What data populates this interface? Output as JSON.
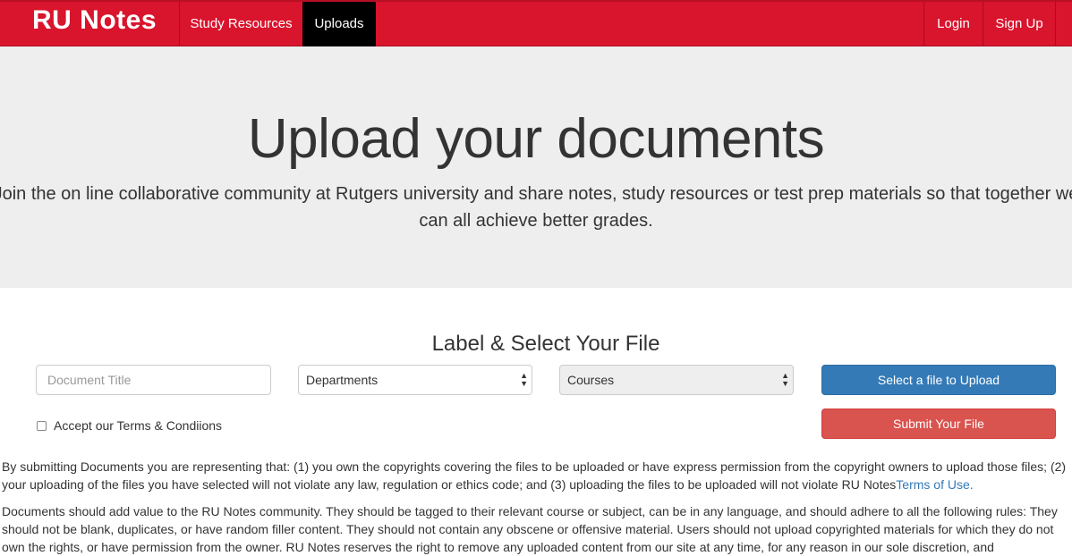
{
  "nav": {
    "brand": "RU Notes",
    "links": [
      "Study Resources",
      "Uploads"
    ],
    "login": "Login",
    "signup": "Sign Up"
  },
  "hero": {
    "title": "Upload your documents",
    "subtitle": "Join the on line collaborative community at Rutgers university and share notes, study resources or test prep materials so that together we can all achieve better grades."
  },
  "form": {
    "title": "Label & Select Your File",
    "doc_title_placeholder": "Document Title",
    "departments": "Departments",
    "courses": "Courses",
    "select_file": "Select a file to Upload",
    "submit": "Submit Your File",
    "terms_label": "Accept our Terms & Condiions"
  },
  "legal": {
    "p1": "By submitting Documents you are representing that: (1) you own the copyrights covering the files to be uploaded or have express permission from the copyright owners to upload those files; (2) your uploading of the files you have selected will not violate any law, regulation or ethics code; and (3) uploading the files to be uploaded will not violate RU Notes",
    "p1_link": "Terms of Use.",
    "p2": "Documents should add value to the RU Notes community. They should be tagged to their relevant course or subject, can be in any language, and should adhere to all the following rules: They should not be blank, duplicates, or have random filler content. They should not contain any obscene or offensive material. Users should not upload copyrighted materials for which they do not own the rights, or have permission from the owner. RU Notes reserves the right to remove any uploaded content from our site at any time, for any reason in our sole discretion, and"
  }
}
